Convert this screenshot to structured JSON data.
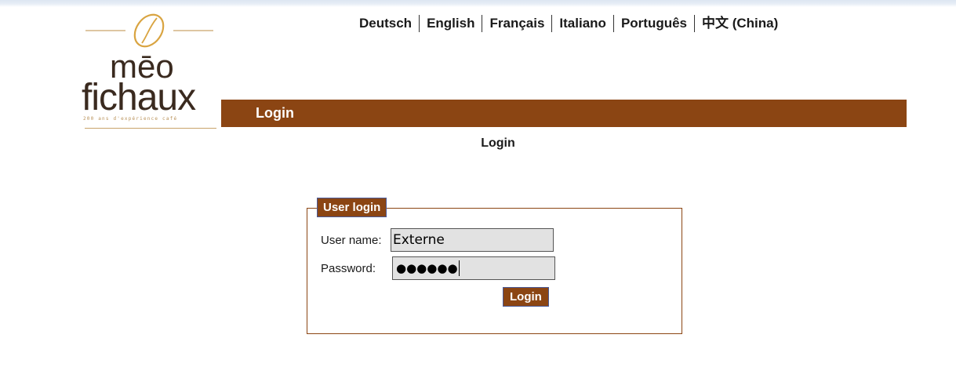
{
  "languages": [
    "Deutsch",
    "English",
    "Français",
    "Italiano",
    "Português",
    "中文 (China)"
  ],
  "logo": {
    "line1": "mēo",
    "line2": "fichaux",
    "tagline": "200 ans d'expérience café"
  },
  "header": {
    "title": "Login"
  },
  "page": {
    "title": "Login"
  },
  "login_form": {
    "legend": "User login",
    "username_label": "User name:",
    "username_value": "Externe",
    "password_label": "Password:",
    "password_masked": "●●●●●●",
    "submit_label": "Login"
  },
  "colors": {
    "brand_brown": "#8b4513",
    "button_border": "#4a5a99"
  }
}
